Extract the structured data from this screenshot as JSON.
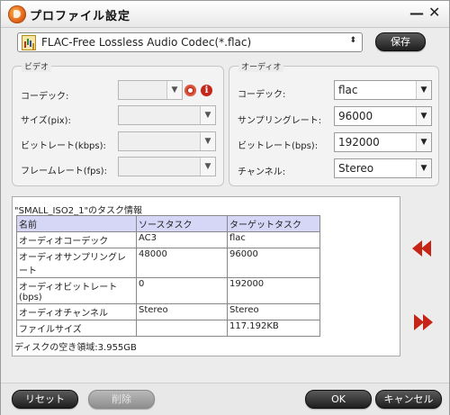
{
  "window": {
    "title": "プロファイル設定",
    "minimize": "—",
    "close": "✕"
  },
  "format": {
    "selected": "FLAC-Free Lossless Audio Codec(*.flac)",
    "arrow": "⬍"
  },
  "save_label": "保存",
  "video": {
    "legend": "ビデオ",
    "codec_label": "コーデック:",
    "size_label": "サイズ(pix):",
    "bitrate_label": "ビットレート(kbps):",
    "framerate_label": "フレームレート(fps):",
    "codec_value": "",
    "size_value": "",
    "bitrate_value": "",
    "framerate_value": ""
  },
  "audio": {
    "legend": "オーディオ",
    "codec_label": "コーデック:",
    "samplerate_label": "サンプリングレート:",
    "bitrate_label": "ビットレート(bps):",
    "channel_label": "チャンネル:",
    "codec_value": "flac",
    "samplerate_value": "96000",
    "bitrate_value": "192000",
    "channel_value": "Stereo"
  },
  "info": {
    "title": "\"SMALL_ISO2_1\"のタスク情報",
    "headers": [
      "名前",
      "ソースタスク",
      "ターゲットタスク"
    ],
    "rows": [
      [
        "オーディオコーデック",
        "AC3",
        "flac"
      ],
      [
        "オーディオサンプリングレート",
        "48000",
        "96000"
      ],
      [
        "オーディオビットレート(bps)",
        "0",
        "192000"
      ],
      [
        "オーディオチャンネル",
        "Stereo",
        "Stereo"
      ],
      [
        "ファイルサイズ",
        "",
        "117.192KB"
      ]
    ],
    "disk_space": "ディスクの空き領域:3.955GB"
  },
  "buttons": {
    "reset": "リセット",
    "delete": "削除",
    "ok": "OK",
    "cancel": "キャンセル"
  },
  "icons": {
    "down_arrow": "▼",
    "info": "i"
  },
  "colors": {
    "accent_red": "#c52417",
    "header_bg": "#d6d6f6"
  }
}
